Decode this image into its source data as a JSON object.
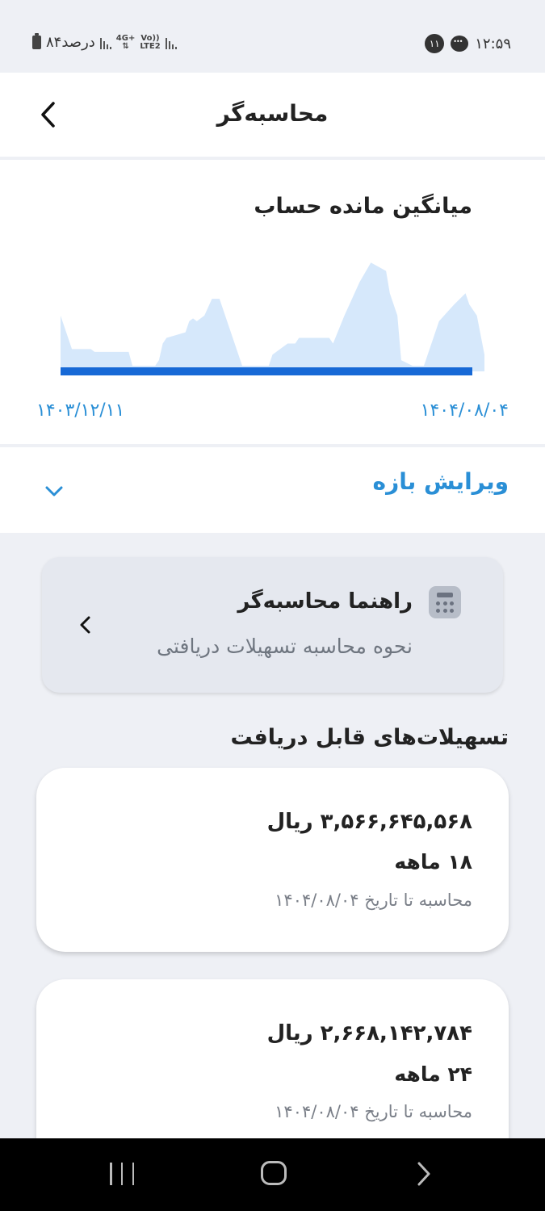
{
  "status_bar": {
    "time": "۱۲:۵۹",
    "notification_count": "۱۱",
    "battery": "۸۴درصد",
    "network_top": "4G+",
    "network_bottom": "LTE2",
    "volte": "Vo))"
  },
  "header": {
    "title": "محاسبه‌گر"
  },
  "chart_data": {
    "type": "area",
    "title": "میانگین مانده حساب",
    "x_start_label": "۱۴۰۳/۱۲/۱۱",
    "x_end_label": "۱۴۰۴/۰۸/۰۴",
    "x": [
      0,
      2,
      3,
      8,
      9,
      18,
      19,
      25,
      26,
      27,
      28,
      33,
      34,
      35,
      36,
      38,
      40,
      42,
      45,
      48,
      55,
      56,
      60,
      62,
      63,
      67,
      71,
      72,
      75,
      79,
      82,
      86,
      87,
      89,
      90,
      93,
      96,
      100,
      104,
      107,
      108,
      110,
      112
    ],
    "values": [
      10,
      6,
      4,
      4,
      3.5,
      3.5,
      1,
      1,
      2,
      5,
      6,
      7,
      9,
      9.5,
      9,
      10,
      13,
      13,
      7,
      1,
      1,
      3,
      5,
      5,
      6,
      6,
      6,
      5,
      10,
      16,
      19.5,
      18,
      14,
      10,
      2,
      1,
      1,
      9,
      12,
      14,
      12,
      10,
      3
    ],
    "ylim": [
      0,
      22
    ],
    "colors": {
      "area": "#d6e8fb",
      "baseline": "#1769d6"
    }
  },
  "range_editor": {
    "label": "ویرایش بازه"
  },
  "guide": {
    "title": "راهنما محاسبه‌گر",
    "subtitle": "نحوه محاسبه تسهیلات دریافتی"
  },
  "facilities": {
    "section_title": "تسهیلات‌های قابل دریافت",
    "items": [
      {
        "amount": "۳,۵۶۶,۶۴۵,۵۶۸ ریال",
        "term": "۱۸ ماهه",
        "date_note": "محاسبه تا تاریخ ۱۴۰۴/۰۸/۰۴"
      },
      {
        "amount": "۲,۶۶۸,۱۴۲,۷۸۴ ریال",
        "term": "۲۴ ماهه",
        "date_note": "محاسبه تا تاریخ ۱۴۰۴/۰۸/۰۴"
      }
    ]
  },
  "colors": {
    "accent": "#2a8fd6",
    "background": "#eef0f5"
  }
}
